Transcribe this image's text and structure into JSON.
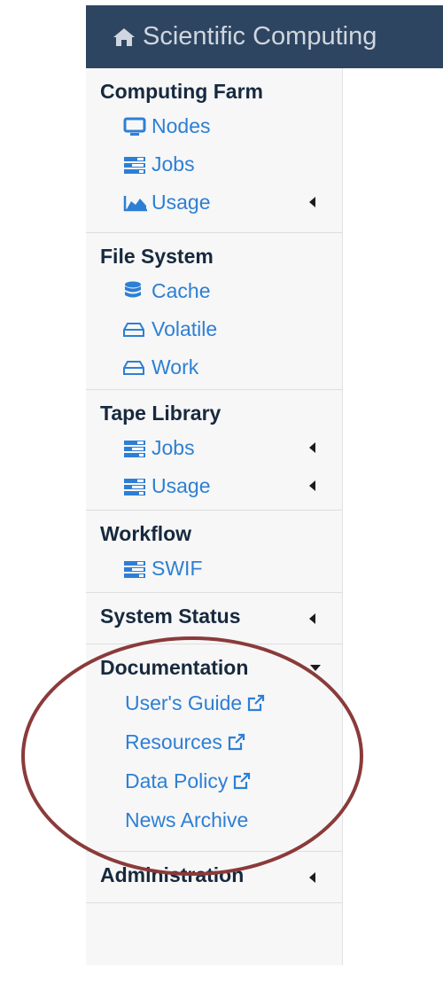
{
  "header": {
    "title": "Scientific Computing",
    "icon": "home-icon"
  },
  "sections": {
    "farm": {
      "title": "Computing Farm",
      "items": [
        {
          "label": "Nodes",
          "icon": "desktop-icon"
        },
        {
          "label": "Jobs",
          "icon": "tasks-icon"
        },
        {
          "label": "Usage",
          "icon": "area-chart-icon"
        }
      ]
    },
    "fs": {
      "title": "File System",
      "items": [
        {
          "label": "Cache",
          "icon": "database-icon"
        },
        {
          "label": "Volatile",
          "icon": "hdd-icon"
        },
        {
          "label": "Work",
          "icon": "hdd-icon"
        }
      ]
    },
    "tape": {
      "title": "Tape Library",
      "items": [
        {
          "label": "Jobs",
          "icon": "tasks-icon"
        },
        {
          "label": "Usage",
          "icon": "tasks-icon"
        }
      ]
    },
    "workflow": {
      "title": "Workflow",
      "items": [
        {
          "label": "SWIF",
          "icon": "tasks-icon"
        }
      ]
    },
    "status": {
      "title": "System Status"
    },
    "docs": {
      "title": "Documentation",
      "items": [
        {
          "label": "User's Guide",
          "icon": "external-link-icon"
        },
        {
          "label": "Resources",
          "icon": "external-link-icon"
        },
        {
          "label": "Data Policy",
          "icon": "external-link-icon"
        },
        {
          "label": "News Archive"
        }
      ]
    },
    "admin": {
      "title": "Administration"
    }
  },
  "colors": {
    "header_bg": "#2e4561",
    "link": "#2d7fd5",
    "annotation": "#8b3a3a"
  }
}
